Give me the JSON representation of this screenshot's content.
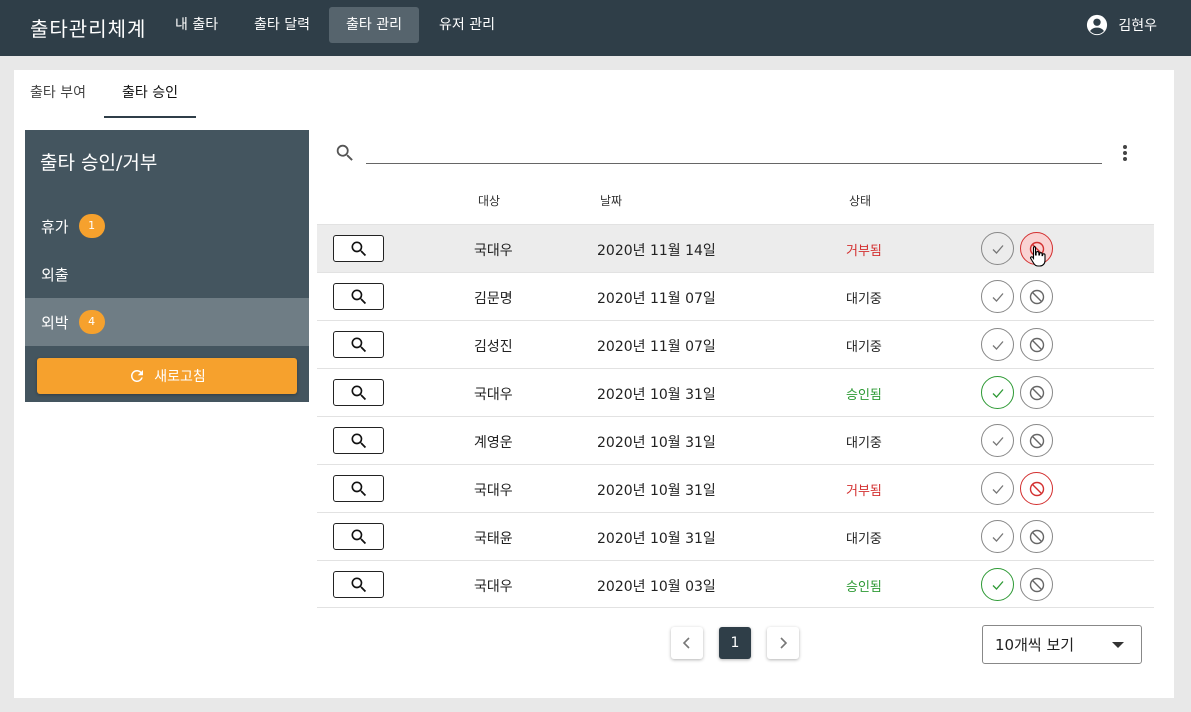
{
  "app": {
    "title": "출타관리체계"
  },
  "nav": {
    "items": [
      {
        "label": "내 출타"
      },
      {
        "label": "출타 달력"
      },
      {
        "label": "출타 관리"
      },
      {
        "label": "유저 관리"
      }
    ],
    "active": "출타 관리"
  },
  "user": {
    "name": "김현우",
    "icon": "account-circle-icon"
  },
  "tabs": [
    {
      "label": "출타 부여"
    },
    {
      "label": "출타 승인"
    }
  ],
  "active_tab": "출타 승인",
  "sidebar": {
    "title": "출타 승인/거부",
    "items": [
      {
        "label": "휴가",
        "count": "1"
      },
      {
        "label": "외출"
      },
      {
        "label": "외박",
        "count": "4"
      }
    ],
    "selected": "외박",
    "refresh_label": "새로고침"
  },
  "search": {
    "placeholder": "",
    "value": ""
  },
  "table": {
    "columns": {
      "target": "대상",
      "date": "날짜",
      "status": "상태"
    },
    "rows": [
      {
        "name": "국대우",
        "date": "2020년 11월 14일",
        "status": "거부됨"
      },
      {
        "name": "김문명",
        "date": "2020년 11월 07일",
        "status": "대기중"
      },
      {
        "name": "김성진",
        "date": "2020년 11월 07일",
        "status": "대기중"
      },
      {
        "name": "국대우",
        "date": "2020년 10월 31일",
        "status": "승인됨"
      },
      {
        "name": "계영운",
        "date": "2020년 10월 31일",
        "status": "대기중"
      },
      {
        "name": "국대우",
        "date": "2020년 10월 31일",
        "status": "거부됨"
      },
      {
        "name": "국태윤",
        "date": "2020년 10월 31일",
        "status": "대기중"
      },
      {
        "name": "국대우",
        "date": "2020년 10월 03일",
        "status": "승인됨"
      }
    ]
  },
  "pagination": {
    "current": "1",
    "page_size": "10개씩 보기"
  },
  "colors": {
    "nav_bg": "#2f3e48",
    "sidebar_bg": "#44555f",
    "accent": "#f6a12d",
    "approved": "#2e9a35",
    "rejected": "#d32f2f"
  }
}
